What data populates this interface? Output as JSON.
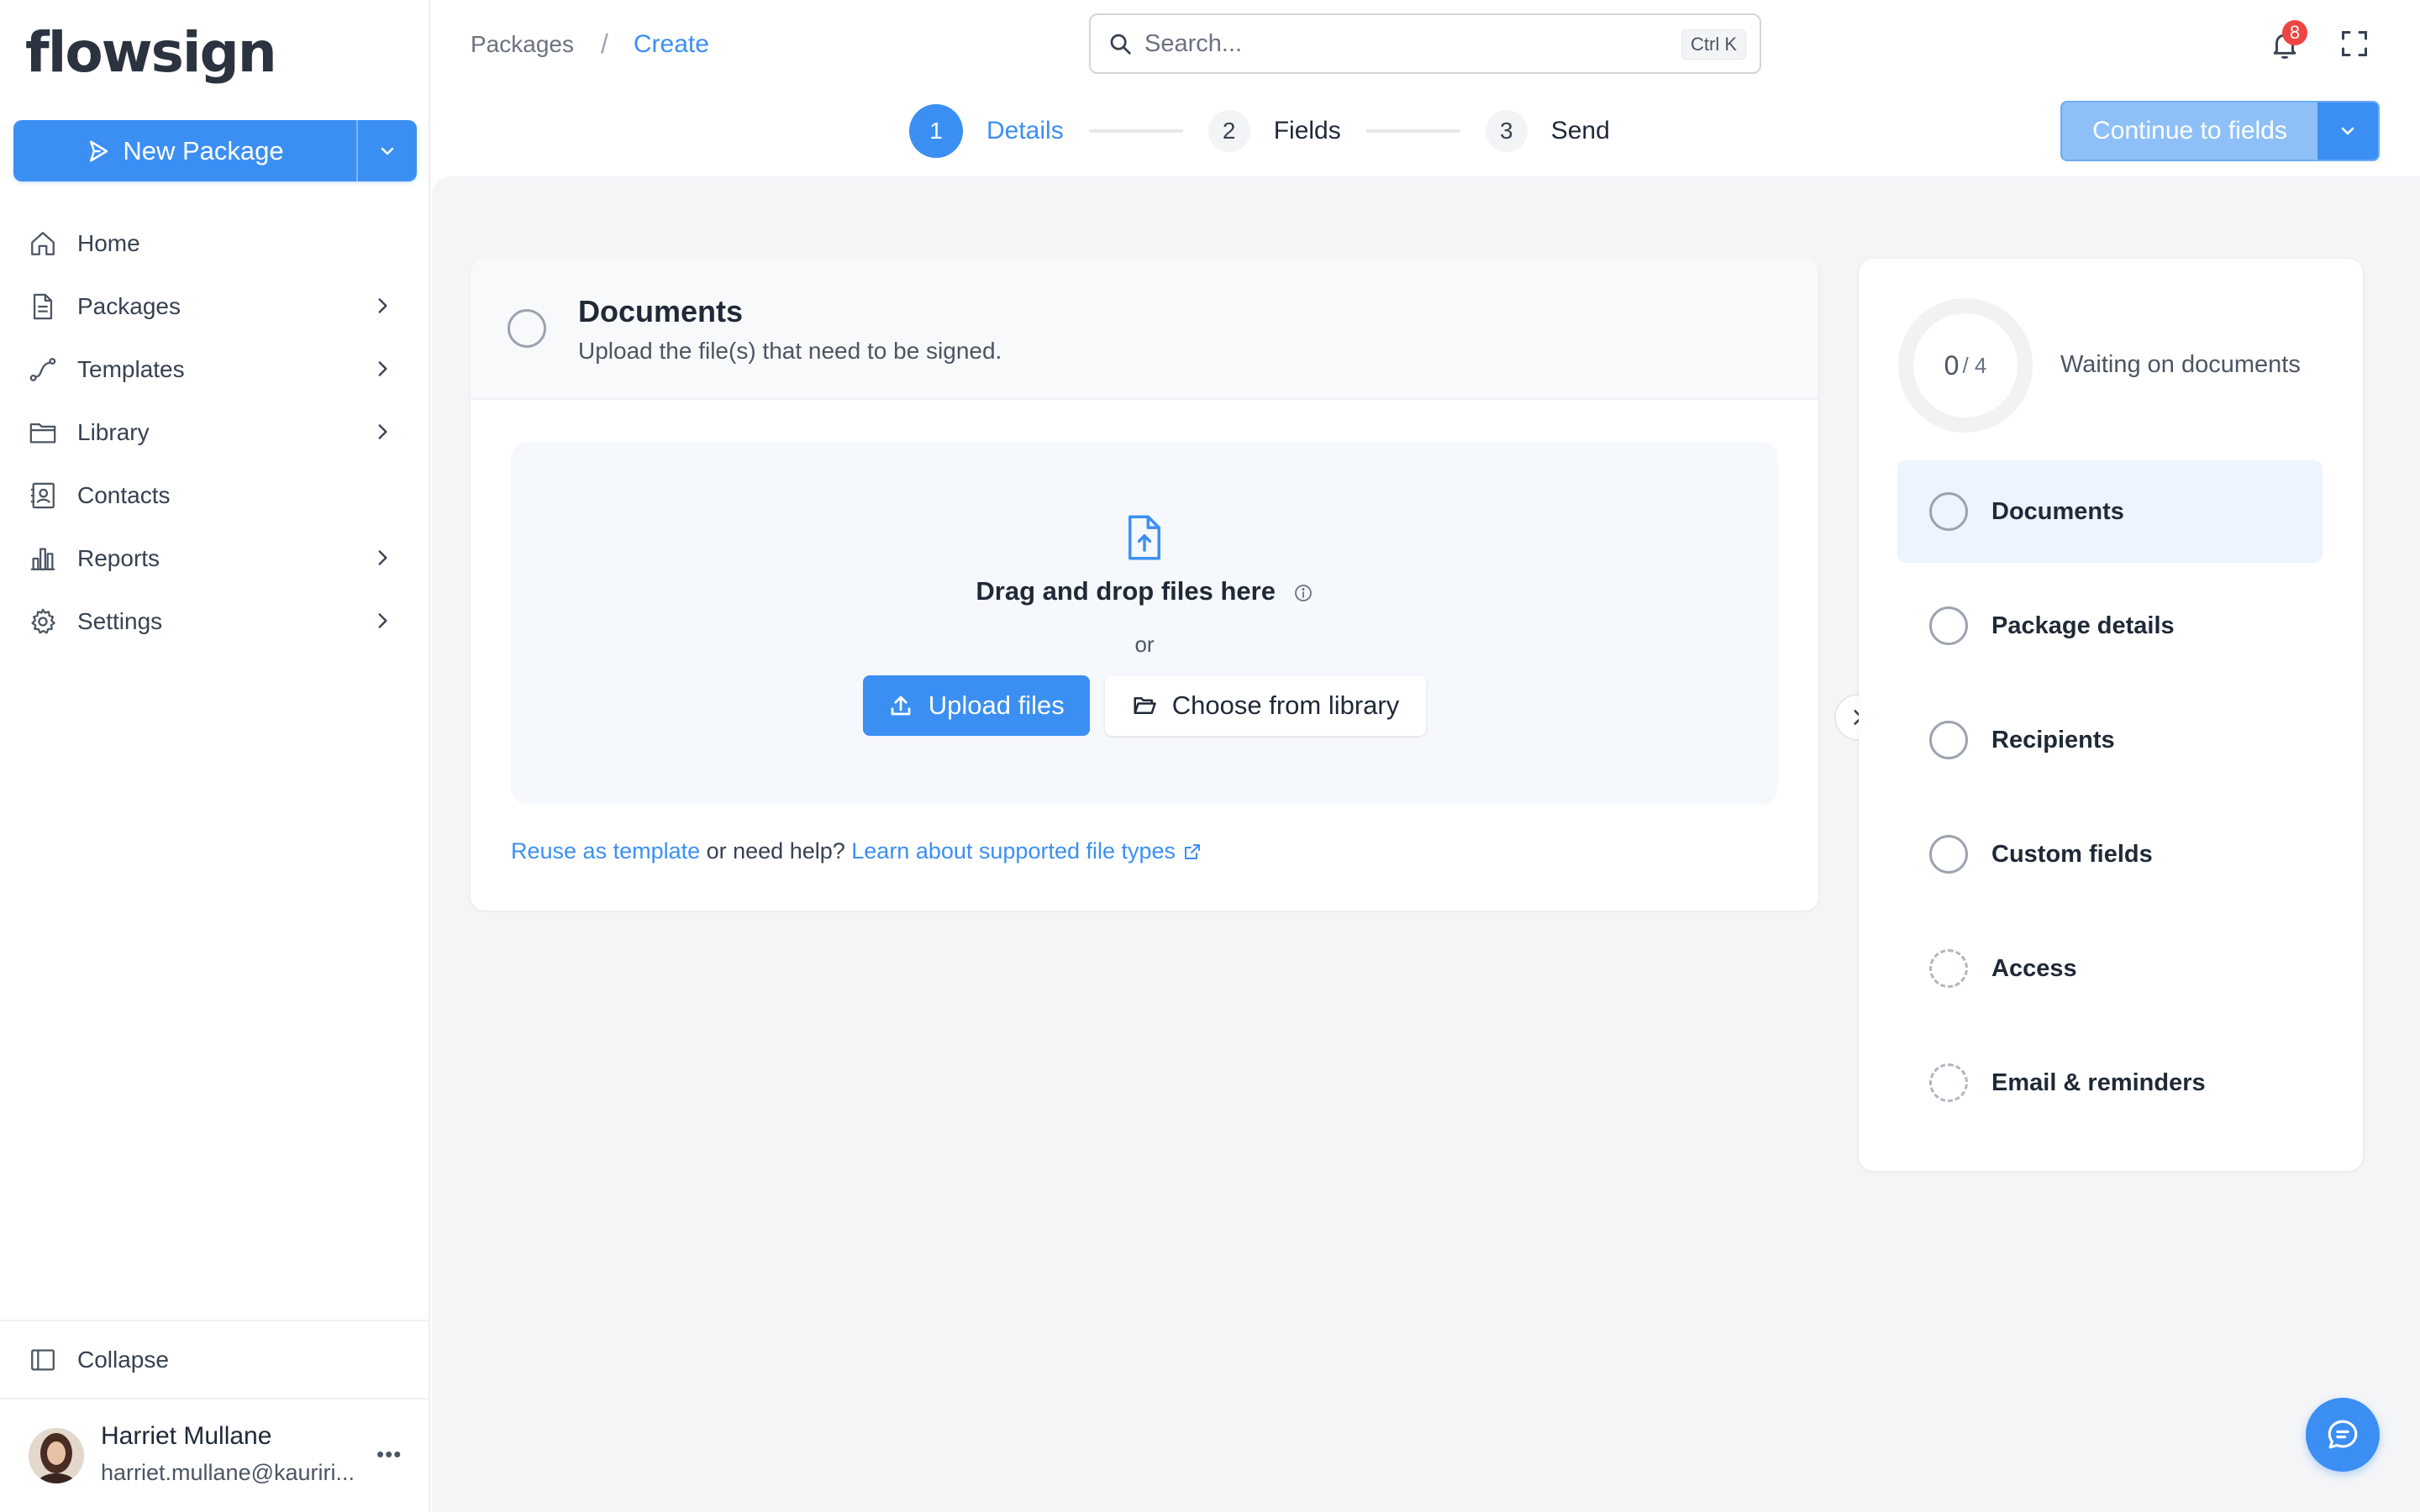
{
  "app": {
    "logo": "flowsign"
  },
  "sidebar": {
    "new_package_label": "New Package",
    "items": [
      {
        "label": "Home",
        "icon": "home-icon",
        "has_chevron": false
      },
      {
        "label": "Packages",
        "icon": "document-icon",
        "has_chevron": true
      },
      {
        "label": "Templates",
        "icon": "route-icon",
        "has_chevron": true
      },
      {
        "label": "Library",
        "icon": "folder-icon",
        "has_chevron": true
      },
      {
        "label": "Contacts",
        "icon": "contacts-icon",
        "has_chevron": false
      },
      {
        "label": "Reports",
        "icon": "bar-chart-icon",
        "has_chevron": true
      },
      {
        "label": "Settings",
        "icon": "gear-icon",
        "has_chevron": true
      }
    ],
    "collapse_label": "Collapse",
    "user": {
      "name": "Harriet Mullane",
      "email": "harriet.mullane@kauriri..."
    }
  },
  "header": {
    "breadcrumb": {
      "parent": "Packages",
      "separator": "/",
      "current": "Create"
    },
    "search": {
      "placeholder": "Search...",
      "shortcut": "Ctrl K"
    },
    "notification_count": "8"
  },
  "stepper": {
    "steps": [
      {
        "number": "1",
        "label": "Details",
        "active": true
      },
      {
        "number": "2",
        "label": "Fields",
        "active": false
      },
      {
        "number": "3",
        "label": "Send",
        "active": false
      }
    ],
    "continue_label": "Continue to fields"
  },
  "documents_card": {
    "title": "Documents",
    "subtitle": "Upload the file(s) that need to be signed.",
    "dropzone": {
      "title": "Drag and drop files here",
      "or": "or",
      "upload_label": "Upload files",
      "library_label": "Choose from library"
    },
    "help": {
      "reuse_link": "Reuse as template",
      "middle_text": " or need help? ",
      "learn_link": "Learn about supported file types"
    }
  },
  "progress": {
    "completed": "0",
    "total": "/ 4",
    "status": "Waiting on documents",
    "items": [
      {
        "label": "Documents",
        "active": true,
        "style": "solid"
      },
      {
        "label": "Package details",
        "active": false,
        "style": "solid"
      },
      {
        "label": "Recipients",
        "active": false,
        "style": "solid"
      },
      {
        "label": "Custom fields",
        "active": false,
        "style": "solid"
      },
      {
        "label": "Access",
        "active": false,
        "style": "dashed"
      },
      {
        "label": "Email & reminders",
        "active": false,
        "style": "dashed"
      }
    ]
  },
  "colors": {
    "accent": "#3b8ff3",
    "accent_light": "#8ec0f7",
    "background": "#f4f5f7",
    "badge": "#ef4444"
  }
}
